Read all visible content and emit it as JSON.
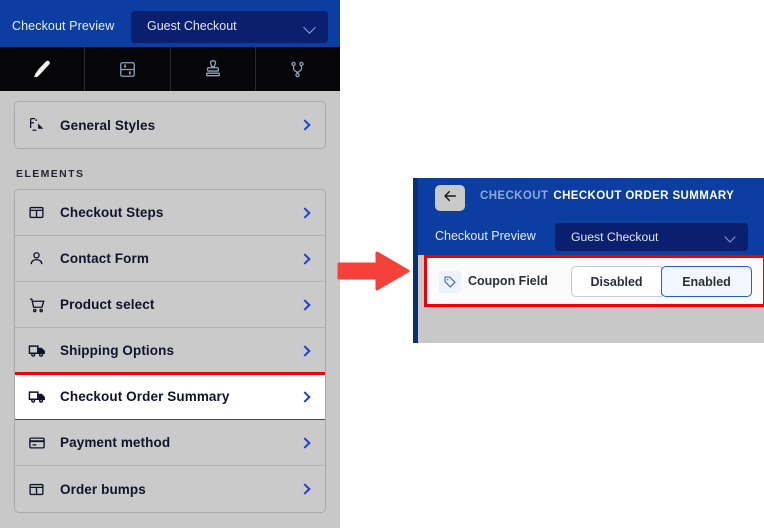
{
  "builder": {
    "topbar": {
      "preview_label": "Checkout Preview",
      "select_value": "Guest Checkout",
      "chevron_icon": "chevron-down-icon"
    },
    "tabs": [
      {
        "name": "design",
        "icon": "paintbrush-icon",
        "active": true
      },
      {
        "name": "settings",
        "icon": "sliders-icon",
        "active": false
      },
      {
        "name": "stamp",
        "icon": "stamp-icon",
        "active": false
      },
      {
        "name": "integrations",
        "icon": "git-branch-icon",
        "active": false
      }
    ],
    "general_styles": {
      "label": "General Styles",
      "icon": "palette-layers-icon"
    },
    "section_title": "ELEMENTS",
    "elements": [
      {
        "label": "Checkout Steps",
        "icon": "columns-icon",
        "highlighted": false
      },
      {
        "label": "Contact Form",
        "icon": "user-icon",
        "highlighted": false
      },
      {
        "label": "Product select",
        "icon": "cart-icon",
        "highlighted": false
      },
      {
        "label": "Shipping Options",
        "icon": "truck-icon",
        "highlighted": false
      },
      {
        "label": "Checkout Order Summary",
        "icon": "truck-icon",
        "highlighted": true
      },
      {
        "label": "Payment method",
        "icon": "credit-card-icon",
        "highlighted": false
      },
      {
        "label": "Order bumps",
        "icon": "columns-icon",
        "highlighted": false
      }
    ]
  },
  "annotation": {
    "arrow_icon": "right-arrow-annotation",
    "arrow_color": "#f4423a",
    "highlight_color": "#f00000"
  },
  "detail_panel": {
    "back_icon": "arrow-left-icon",
    "breadcrumb": "CHECKOUT",
    "title": "CHECKOUT ORDER SUMMARY",
    "subbar": {
      "preview_label": "Checkout Preview",
      "select_value": "Guest Checkout",
      "chevron_icon": "chevron-down-icon"
    },
    "setting": {
      "icon": "tag-icon",
      "label": "Coupon Field",
      "options": [
        "Disabled",
        "Enabled"
      ],
      "selected": "Enabled"
    }
  }
}
